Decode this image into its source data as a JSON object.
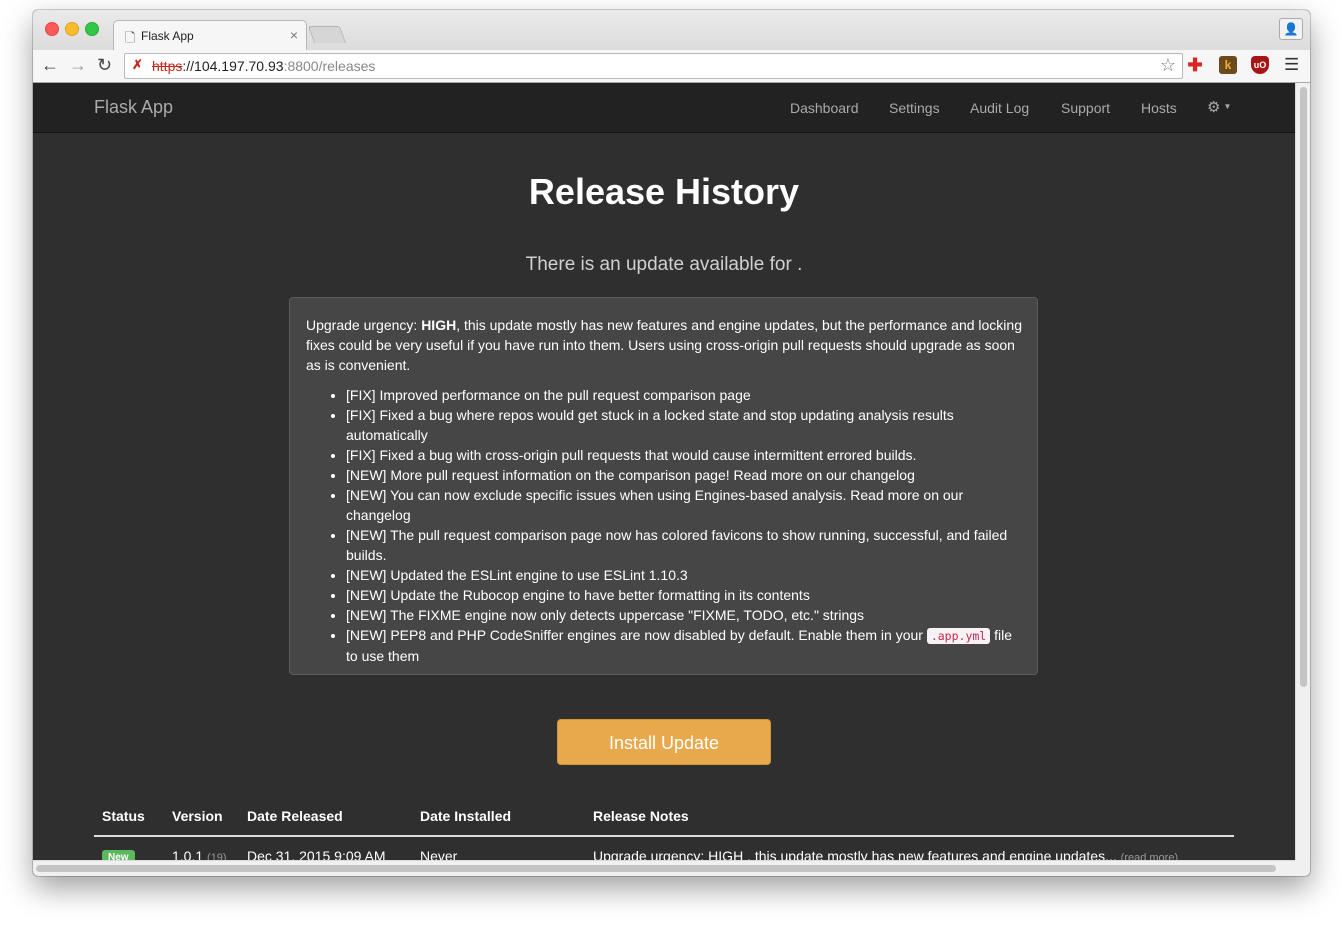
{
  "browser": {
    "tab_title": "Flask App",
    "tab_close": "×",
    "url_scheme": "https",
    "url_host": "://104.197.70.93",
    "url_path": ":8800/releases",
    "icons": {
      "page": "document-icon",
      "back": "arrow-left-icon",
      "forward": "arrow-right-icon",
      "reload": "reload-icon",
      "ssl_error": "broken-lock-icon",
      "bookmark": "star-icon",
      "menu": "hamburger-icon"
    },
    "extensions": [
      "red-cross-extension-icon",
      "k-extension-icon",
      "ublock-icon"
    ]
  },
  "navbar": {
    "brand": "Flask App",
    "links": [
      "Dashboard",
      "Settings",
      "Audit Log",
      "Support",
      "Hosts"
    ],
    "settings_icon": "gear-icon"
  },
  "page": {
    "title": "Release History",
    "lead": "There is an update available for ."
  },
  "notes": {
    "intro_label": "Upgrade urgency: ",
    "intro_strong": "HIGH",
    "intro_rest": ", this update mostly has new features and engine updates, but the performance and locking fixes could be very useful if you have run into them. Users using cross-origin pull requests should upgrade as soon as is convenient.",
    "items": [
      "[FIX] Improved performance on the pull request comparison page",
      "[FIX] Fixed a bug where repos would get stuck in a locked state and stop updating analysis results automatically",
      "[FIX] Fixed a bug with cross-origin pull requests that would cause intermittent errored builds.",
      "[NEW] More pull request information on the comparison page! Read more on our changelog",
      "[NEW] You can now exclude specific issues when using Engines-based analysis. Read more on our changelog",
      "[NEW] The pull request comparison page now has colored favicons to show running, successful, and failed builds.",
      "[NEW] Updated the ESLint engine to use ESLint 1.10.3",
      "[NEW] Update the Rubocop engine to have better formatting in its contents",
      "[NEW] The FIXME engine now only detects uppercase \"FIXME, TODO, etc.\" strings"
    ],
    "last_item_pre": "[NEW] PEP8 and PHP CodeSniffer engines are now disabled by default. Enable them in your ",
    "last_item_code": ".app.yml",
    "last_item_post": " file to use them"
  },
  "install_button": "Install Update",
  "table": {
    "headers": [
      "Status",
      "Version",
      "Date Released",
      "Date Installed",
      "Release Notes"
    ],
    "rows": [
      {
        "status": "New",
        "version": "1.0.1",
        "build": "(19)",
        "date_released": "Dec 31, 2015 9:09 AM",
        "date_installed": "Never",
        "notes": "Upgrade urgency: HIGH , this update mostly has new features and engine updates...",
        "read_more": "(read more)"
      }
    ]
  },
  "colors": {
    "page_bg": "#2f2f2f",
    "navbar_bg": "#222222",
    "well_bg": "#464646",
    "button_warning": "#e8a84c",
    "label_success": "#5cb85c",
    "code_text": "#c7254e"
  }
}
